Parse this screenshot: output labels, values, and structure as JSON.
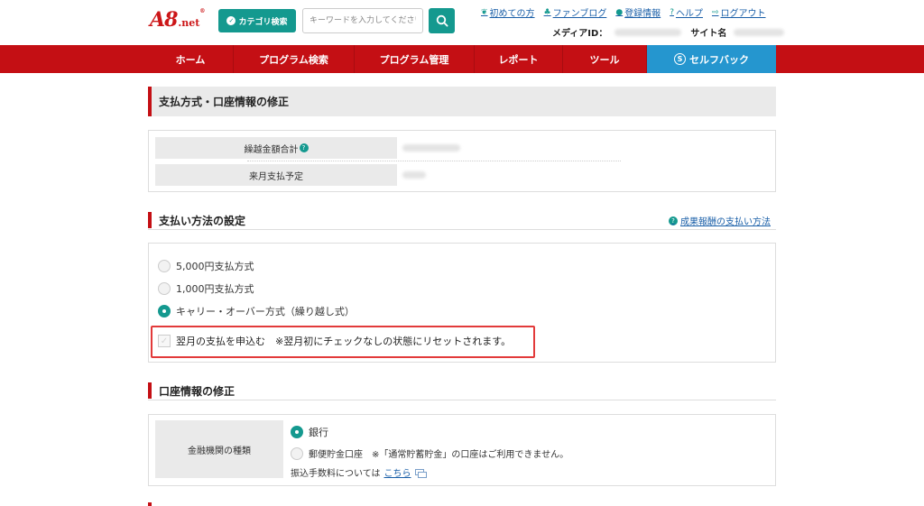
{
  "header": {
    "logo": "A8",
    "logo_suffix": ".net",
    "logo_mark": "®",
    "category_button": "カテゴリ検索",
    "search_placeholder": "キーワードを入力してください",
    "links": [
      "初めての方",
      "ファンブログ",
      "登録情報",
      "ヘルプ",
      "ログアウト"
    ],
    "media_id_label": "メディアID：",
    "site_name_label": "サイト名"
  },
  "nav": {
    "items": [
      "ホーム",
      "プログラム検索",
      "プログラム管理",
      "レポート",
      "ツール",
      "セルフバック"
    ]
  },
  "page_title": "支払方式・口座情報の修正",
  "balance": {
    "carryover_label": "繰越金額合計",
    "next_month_label": "来月支払予定"
  },
  "payment_section": {
    "title": "支払い方法の設定",
    "help_link": "成果報酬の支払い方法",
    "options": [
      "5,000円支払方式",
      "1,000円支払方式",
      "キャリー・オーバー方式（繰り越し式）"
    ],
    "selected": "キャリー・オーバー方式（繰り越し式）",
    "checkbox_label": "翌月の支払を申込む　※翌月初にチェックなしの状態にリセットされます。"
  },
  "account_section": {
    "title": "口座情報の修正",
    "institution_label": "金融機関の種類",
    "options": [
      "銀行",
      "郵便貯金口座　※「通常貯蓄貯金」の口座はご利用できません。"
    ],
    "selected": "銀行",
    "fee_note": "振込手数料については",
    "fee_link": "こちら"
  },
  "colors": {
    "brand_red": "#c40f14",
    "accent_teal": "#14998f",
    "selfback_blue": "#2596cf",
    "highlight_red": "#e23a3a"
  }
}
